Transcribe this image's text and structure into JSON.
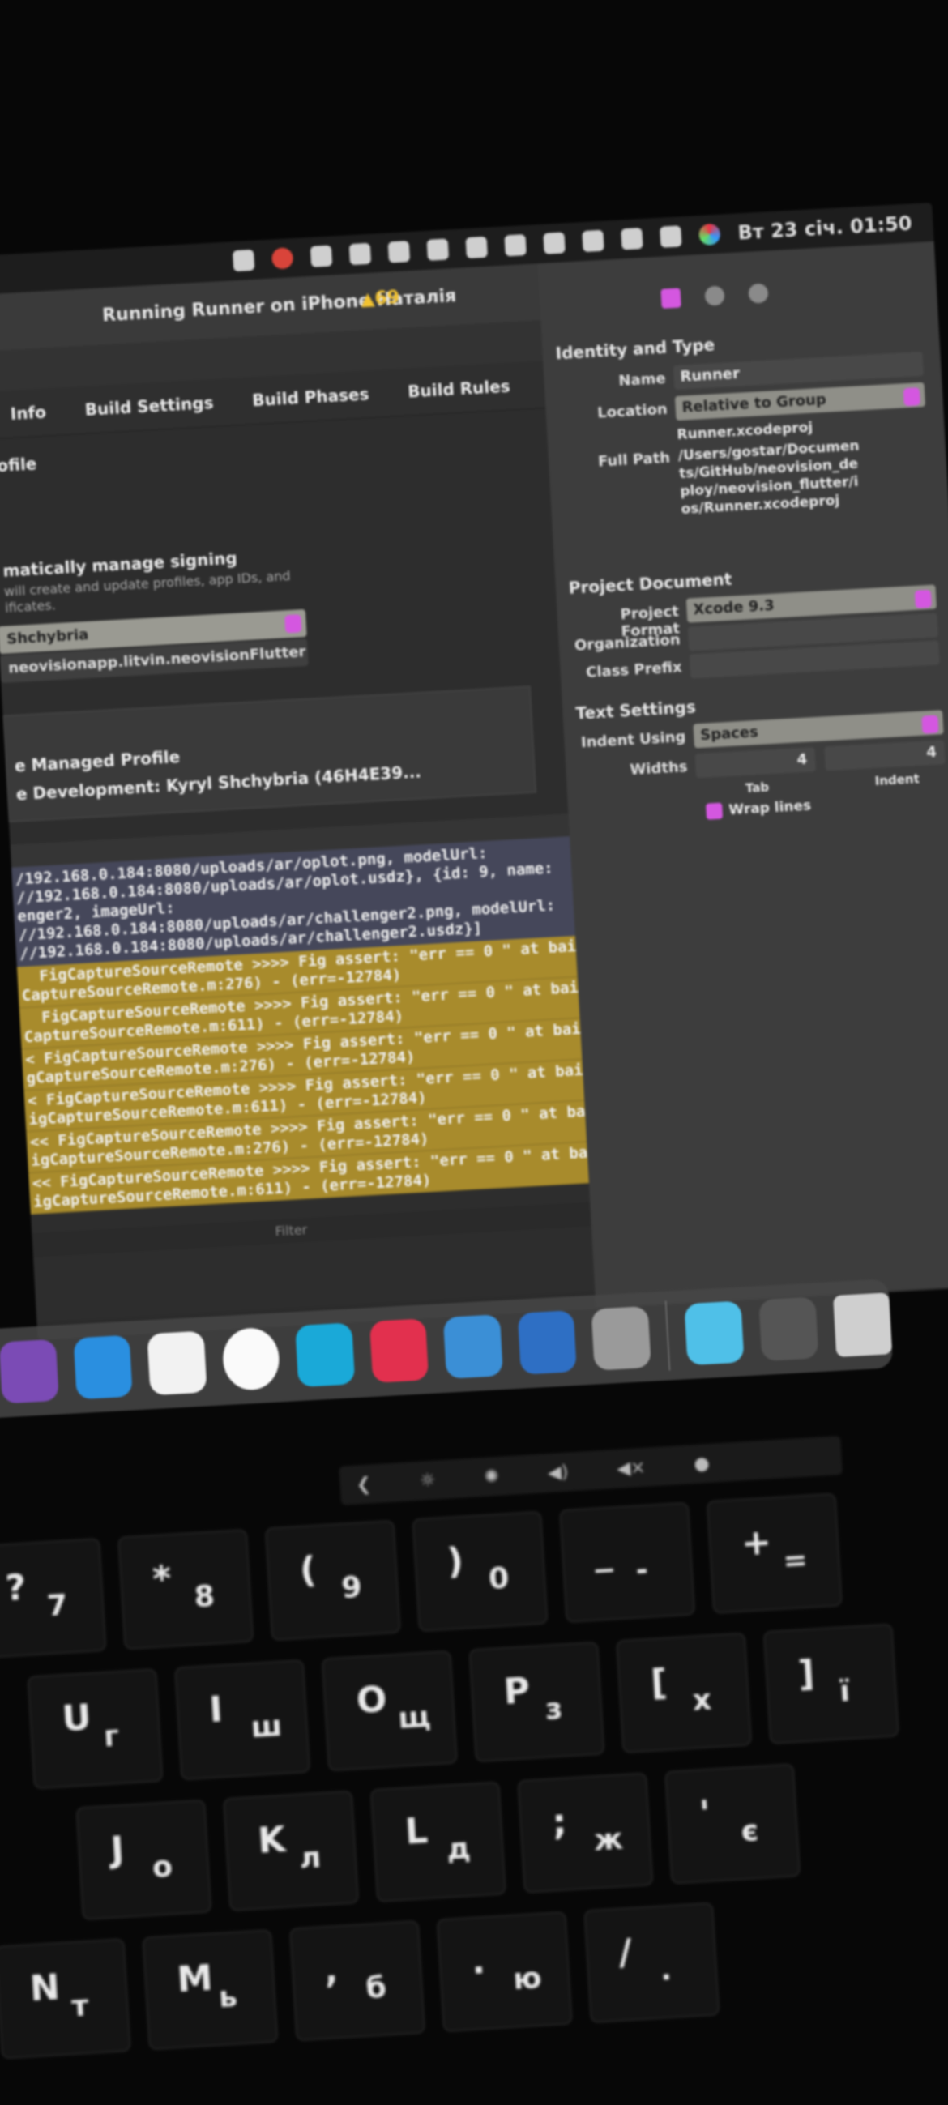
{
  "menubar": {
    "datetime": "Вт 23 січ. 01:50"
  },
  "xcode": {
    "activity": "Running Runner on iPhone Наталія",
    "warnings": "▲69",
    "tabs": [
      "Info",
      "Build Settings",
      "Build Phases",
      "Build Rules"
    ],
    "section_partial": "ofile",
    "auto_signing": "matically manage signing",
    "auto_signing_desc": "will create and update profiles, app IDs, and",
    "auto_signing_desc2": "ificates.",
    "team": "Shchybria",
    "bundle_id": "neovisionapp.litvin.neovisionFlutter",
    "profile": "e Managed Profile",
    "certificate": "e Development: Kyryl Shchybria (46H4E39..."
  },
  "console": {
    "blue_lines": [
      "/192.168.0.184:8080/uploads/ar/oplot.png, modelUrl:",
      "//192.168.0.184:8080/uploads/ar/oplot.usdz}, {id: 9, name:",
      "enger2, imageUrl:",
      "//192.168.0.184:8080/uploads/ar/challenger2.png, modelUrl:",
      "//192.168.0.184:8080/uploads/ar/challenger2.usdz}]"
    ],
    "gold_pairs": [
      [
        "  FigCaptureSourceRemote >>>> Fig assert: \"err == 0 \" at bail",
        "CaptureSourceRemote.m:276) - (err=-12784)"
      ],
      [
        "  FigCaptureSourceRemote >>>> Fig assert: \"err == 0 \" at bail",
        "CaptureSourceRemote.m:611) - (err=-12784)"
      ],
      [
        "< FigCaptureSourceRemote >>>> Fig assert: \"err == 0 \" at bail",
        "gCaptureSourceRemote.m:276) - (err=-12784)"
      ],
      [
        "< FigCaptureSourceRemote >>>> Fig assert: \"err == 0 \" at bail",
        "igCaptureSourceRemote.m:611) - (err=-12784)"
      ],
      [
        "<< FigCaptureSourceRemote >>>> Fig assert: \"err == 0 \" at bail",
        "igCaptureSourceRemote.m:276) - (err=-12784)"
      ],
      [
        "<< FigCaptureSourceRemote >>>> Fig assert: \"err == 0 \" at bail",
        "igCaptureSourceRemote.m:611) - (err=-12784)"
      ]
    ],
    "filter_placeholder": "Filter"
  },
  "inspector": {
    "identity_title": "Identity and Type",
    "name_label": "Name",
    "name_value": "Runner",
    "location_label": "Location",
    "location_value": "Relative to Group",
    "location_file": "Runner.xcodeproj",
    "fullpath_label": "Full Path",
    "fullpath_value": "/Users/gostar/Documents/GitHub/neovision_deploy/neovision_flutter/ios/Runner.xcodeproj",
    "project_doc_title": "Project Document",
    "format_label": "Project Format",
    "format_value": "Xcode 9.3",
    "org_label": "Organization",
    "prefix_label": "Class Prefix",
    "text_title": "Text Settings",
    "indent_label": "Indent Using",
    "indent_value": "Spaces",
    "widths_label": "Widths",
    "tab_width": "4",
    "indent_width": "4",
    "tab_label": "Tab",
    "indent_sub_label": "Indent",
    "wrap_label": "Wrap lines",
    "wrap_checked": true
  },
  "accent_color": "#d457e0",
  "console_warning_color": "#a88b2c",
  "dock": {
    "apps": [
      "github-desktop",
      "docker",
      "vscode",
      "instruments",
      "webstorm",
      "intellij",
      "xcode-simulator",
      "xcode",
      "system-preferences",
      "downloads-folder",
      "trash"
    ]
  },
  "keyboard": {
    "rows": [
      [
        [
          "7",
          "?"
        ],
        [
          "8",
          "*"
        ],
        [
          "9",
          "("
        ],
        [
          "0",
          ")"
        ],
        [
          "-",
          "_"
        ],
        [
          "=",
          "+"
        ]
      ],
      [
        [
          "U",
          "г"
        ],
        [
          "I",
          "ш"
        ],
        [
          "O",
          "щ"
        ],
        [
          "P",
          "з"
        ],
        [
          "[",
          "х"
        ],
        [
          "]",
          "ї"
        ]
      ],
      [
        [
          "J",
          "о"
        ],
        [
          "K",
          "л"
        ],
        [
          "L",
          "д"
        ],
        [
          ";",
          "ж"
        ],
        [
          "'",
          "є"
        ]
      ],
      [
        [
          "N",
          "т"
        ],
        [
          "M",
          "ь"
        ],
        [
          ",",
          "б"
        ],
        [
          ".",
          "ю"
        ],
        [
          "/",
          "."
        ]
      ]
    ]
  }
}
